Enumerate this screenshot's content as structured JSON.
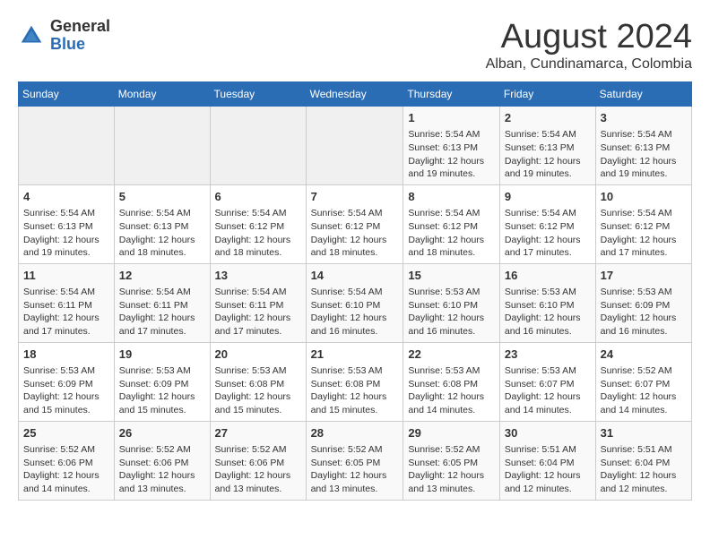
{
  "header": {
    "logo_general": "General",
    "logo_blue": "Blue",
    "main_title": "August 2024",
    "subtitle": "Alban, Cundinamarca, Colombia"
  },
  "days_of_week": [
    "Sunday",
    "Monday",
    "Tuesday",
    "Wednesday",
    "Thursday",
    "Friday",
    "Saturday"
  ],
  "weeks": [
    [
      {
        "day": "",
        "info": ""
      },
      {
        "day": "",
        "info": ""
      },
      {
        "day": "",
        "info": ""
      },
      {
        "day": "",
        "info": ""
      },
      {
        "day": "1",
        "info": "Sunrise: 5:54 AM\nSunset: 6:13 PM\nDaylight: 12 hours\nand 19 minutes."
      },
      {
        "day": "2",
        "info": "Sunrise: 5:54 AM\nSunset: 6:13 PM\nDaylight: 12 hours\nand 19 minutes."
      },
      {
        "day": "3",
        "info": "Sunrise: 5:54 AM\nSunset: 6:13 PM\nDaylight: 12 hours\nand 19 minutes."
      }
    ],
    [
      {
        "day": "4",
        "info": "Sunrise: 5:54 AM\nSunset: 6:13 PM\nDaylight: 12 hours\nand 19 minutes."
      },
      {
        "day": "5",
        "info": "Sunrise: 5:54 AM\nSunset: 6:13 PM\nDaylight: 12 hours\nand 18 minutes."
      },
      {
        "day": "6",
        "info": "Sunrise: 5:54 AM\nSunset: 6:12 PM\nDaylight: 12 hours\nand 18 minutes."
      },
      {
        "day": "7",
        "info": "Sunrise: 5:54 AM\nSunset: 6:12 PM\nDaylight: 12 hours\nand 18 minutes."
      },
      {
        "day": "8",
        "info": "Sunrise: 5:54 AM\nSunset: 6:12 PM\nDaylight: 12 hours\nand 18 minutes."
      },
      {
        "day": "9",
        "info": "Sunrise: 5:54 AM\nSunset: 6:12 PM\nDaylight: 12 hours\nand 17 minutes."
      },
      {
        "day": "10",
        "info": "Sunrise: 5:54 AM\nSunset: 6:12 PM\nDaylight: 12 hours\nand 17 minutes."
      }
    ],
    [
      {
        "day": "11",
        "info": "Sunrise: 5:54 AM\nSunset: 6:11 PM\nDaylight: 12 hours\nand 17 minutes."
      },
      {
        "day": "12",
        "info": "Sunrise: 5:54 AM\nSunset: 6:11 PM\nDaylight: 12 hours\nand 17 minutes."
      },
      {
        "day": "13",
        "info": "Sunrise: 5:54 AM\nSunset: 6:11 PM\nDaylight: 12 hours\nand 17 minutes."
      },
      {
        "day": "14",
        "info": "Sunrise: 5:54 AM\nSunset: 6:10 PM\nDaylight: 12 hours\nand 16 minutes."
      },
      {
        "day": "15",
        "info": "Sunrise: 5:53 AM\nSunset: 6:10 PM\nDaylight: 12 hours\nand 16 minutes."
      },
      {
        "day": "16",
        "info": "Sunrise: 5:53 AM\nSunset: 6:10 PM\nDaylight: 12 hours\nand 16 minutes."
      },
      {
        "day": "17",
        "info": "Sunrise: 5:53 AM\nSunset: 6:09 PM\nDaylight: 12 hours\nand 16 minutes."
      }
    ],
    [
      {
        "day": "18",
        "info": "Sunrise: 5:53 AM\nSunset: 6:09 PM\nDaylight: 12 hours\nand 15 minutes."
      },
      {
        "day": "19",
        "info": "Sunrise: 5:53 AM\nSunset: 6:09 PM\nDaylight: 12 hours\nand 15 minutes."
      },
      {
        "day": "20",
        "info": "Sunrise: 5:53 AM\nSunset: 6:08 PM\nDaylight: 12 hours\nand 15 minutes."
      },
      {
        "day": "21",
        "info": "Sunrise: 5:53 AM\nSunset: 6:08 PM\nDaylight: 12 hours\nand 15 minutes."
      },
      {
        "day": "22",
        "info": "Sunrise: 5:53 AM\nSunset: 6:08 PM\nDaylight: 12 hours\nand 14 minutes."
      },
      {
        "day": "23",
        "info": "Sunrise: 5:53 AM\nSunset: 6:07 PM\nDaylight: 12 hours\nand 14 minutes."
      },
      {
        "day": "24",
        "info": "Sunrise: 5:52 AM\nSunset: 6:07 PM\nDaylight: 12 hours\nand 14 minutes."
      }
    ],
    [
      {
        "day": "25",
        "info": "Sunrise: 5:52 AM\nSunset: 6:06 PM\nDaylight: 12 hours\nand 14 minutes."
      },
      {
        "day": "26",
        "info": "Sunrise: 5:52 AM\nSunset: 6:06 PM\nDaylight: 12 hours\nand 13 minutes."
      },
      {
        "day": "27",
        "info": "Sunrise: 5:52 AM\nSunset: 6:06 PM\nDaylight: 12 hours\nand 13 minutes."
      },
      {
        "day": "28",
        "info": "Sunrise: 5:52 AM\nSunset: 6:05 PM\nDaylight: 12 hours\nand 13 minutes."
      },
      {
        "day": "29",
        "info": "Sunrise: 5:52 AM\nSunset: 6:05 PM\nDaylight: 12 hours\nand 13 minutes."
      },
      {
        "day": "30",
        "info": "Sunrise: 5:51 AM\nSunset: 6:04 PM\nDaylight: 12 hours\nand 12 minutes."
      },
      {
        "day": "31",
        "info": "Sunrise: 5:51 AM\nSunset: 6:04 PM\nDaylight: 12 hours\nand 12 minutes."
      }
    ]
  ]
}
